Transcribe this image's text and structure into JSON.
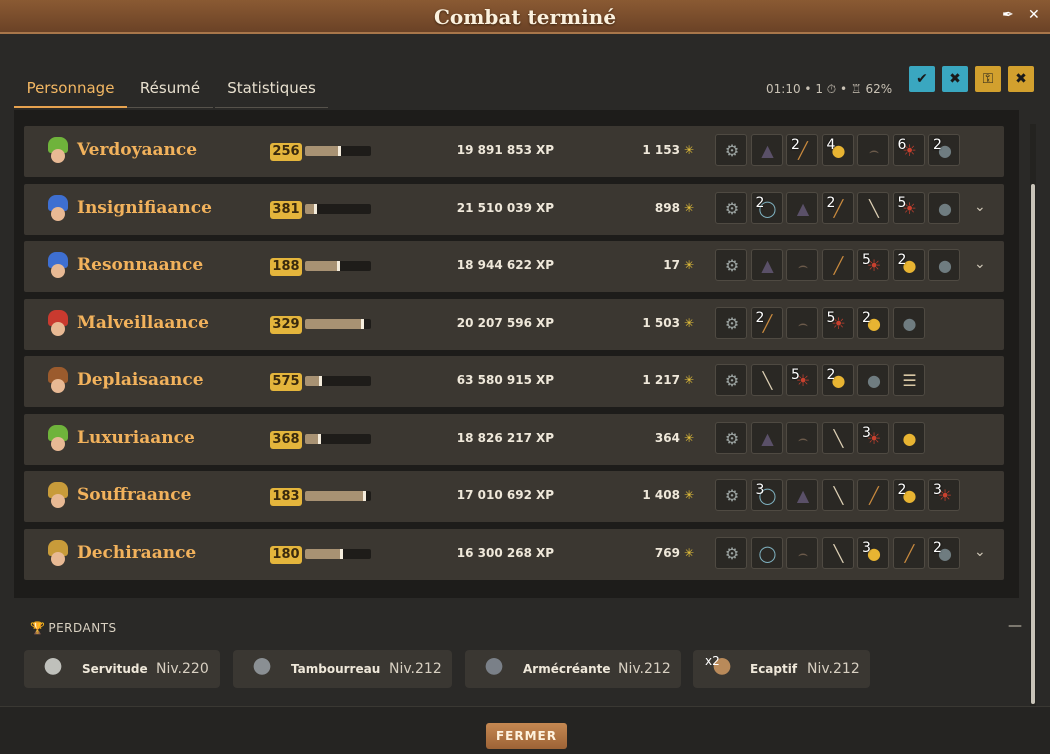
{
  "window": {
    "title": "Combat terminé"
  },
  "tabs": [
    {
      "label": "Personnage",
      "active": true
    },
    {
      "label": "Résumé",
      "active": false
    },
    {
      "label": "Statistiques",
      "active": false
    }
  ],
  "status": {
    "time": "01:10",
    "turns": "1",
    "challenge_pct": "62%"
  },
  "option_buttons": [
    {
      "icon": "check-groups-icon",
      "color": "#3aa7c0"
    },
    {
      "icon": "no-tree-icon",
      "color": "#3aa7c0"
    },
    {
      "icon": "lock-icon",
      "color": "#d2a02e"
    },
    {
      "icon": "no-helpers-icon",
      "color": "#d2a02e"
    }
  ],
  "players": [
    {
      "name": "Verdoyaance",
      "level": "256",
      "xp_progress": 0.55,
      "xp": "19 891 853",
      "xp_unit": "XP",
      "kamas": "1 153",
      "hat": "#6fb33b",
      "loot": [
        {
          "icon": "scrap-icon",
          "qty": ""
        },
        {
          "icon": "hood-icon",
          "qty": ""
        },
        {
          "icon": "staff-icon",
          "qty": "2"
        },
        {
          "icon": "coin-icon",
          "qty": "4"
        },
        {
          "icon": "whip-icon",
          "qty": ""
        },
        {
          "icon": "meat-icon",
          "qty": "6"
        },
        {
          "icon": "bomb-icon",
          "qty": "2"
        }
      ],
      "expandable": false
    },
    {
      "name": "Insignifiaance",
      "level": "381",
      "xp_progress": 0.18,
      "xp": "21 510 039",
      "xp_unit": "XP",
      "kamas": "898",
      "hat": "#3e6fd1",
      "loot": [
        {
          "icon": "scrap-icon",
          "qty": ""
        },
        {
          "icon": "ring-icon",
          "qty": "2"
        },
        {
          "icon": "hood-icon",
          "qty": ""
        },
        {
          "icon": "staff-icon",
          "qty": "2"
        },
        {
          "icon": "mace-icon",
          "qty": ""
        },
        {
          "icon": "meat-icon",
          "qty": "5"
        },
        {
          "icon": "bomb-icon",
          "qty": ""
        }
      ],
      "expandable": true
    },
    {
      "name": "Resonnaance",
      "level": "188",
      "xp_progress": 0.53,
      "xp": "18 944 622",
      "xp_unit": "XP",
      "kamas": "17",
      "hat": "#3e6fd1",
      "loot": [
        {
          "icon": "scrap-icon",
          "qty": ""
        },
        {
          "icon": "hood-icon",
          "qty": ""
        },
        {
          "icon": "whip-icon",
          "qty": ""
        },
        {
          "icon": "staff-icon",
          "qty": ""
        },
        {
          "icon": "meat-icon",
          "qty": "5"
        },
        {
          "icon": "coin-icon",
          "qty": "2"
        },
        {
          "icon": "bomb-icon",
          "qty": ""
        }
      ],
      "expandable": true
    },
    {
      "name": "Malveillaance",
      "level": "329",
      "xp_progress": 0.9,
      "xp": "20 207 596",
      "xp_unit": "XP",
      "kamas": "1 503",
      "hat": "#c93a2f",
      "loot": [
        {
          "icon": "scrap-icon",
          "qty": ""
        },
        {
          "icon": "staff-icon",
          "qty": "2"
        },
        {
          "icon": "whip-icon",
          "qty": ""
        },
        {
          "icon": "meat-icon",
          "qty": "5"
        },
        {
          "icon": "coin-icon",
          "qty": "2"
        },
        {
          "icon": "bomb-icon",
          "qty": ""
        }
      ],
      "expandable": false
    },
    {
      "name": "Deplaisaance",
      "level": "575",
      "xp_progress": 0.25,
      "xp": "63 580 915",
      "xp_unit": "XP",
      "kamas": "1 217",
      "hat": "#9b5b2d",
      "loot": [
        {
          "icon": "scrap-icon",
          "qty": ""
        },
        {
          "icon": "mace-icon",
          "qty": ""
        },
        {
          "icon": "meat-icon",
          "qty": "5"
        },
        {
          "icon": "coin-icon",
          "qty": "2"
        },
        {
          "icon": "bomb-icon",
          "qty": ""
        },
        {
          "icon": "scroll-icon",
          "qty": ""
        }
      ],
      "expandable": false
    },
    {
      "name": "Luxuriaance",
      "level": "368",
      "xp_progress": 0.24,
      "xp": "18 826 217",
      "xp_unit": "XP",
      "kamas": "364",
      "hat": "#6fb33b",
      "loot": [
        {
          "icon": "scrap-icon",
          "qty": ""
        },
        {
          "icon": "hood-icon",
          "qty": ""
        },
        {
          "icon": "whip-icon",
          "qty": ""
        },
        {
          "icon": "mace-icon",
          "qty": ""
        },
        {
          "icon": "meat-icon",
          "qty": "3"
        },
        {
          "icon": "coin-icon",
          "qty": ""
        }
      ],
      "expandable": false
    },
    {
      "name": "Souffraance",
      "level": "183",
      "xp_progress": 0.92,
      "xp": "17 010 692",
      "xp_unit": "XP",
      "kamas": "1 408",
      "hat": "#c89b3a",
      "loot": [
        {
          "icon": "scrap-icon",
          "qty": ""
        },
        {
          "icon": "ring-icon",
          "qty": "3"
        },
        {
          "icon": "hood-icon",
          "qty": ""
        },
        {
          "icon": "mace-icon",
          "qty": ""
        },
        {
          "icon": "staff-icon",
          "qty": ""
        },
        {
          "icon": "coin-icon",
          "qty": "2"
        },
        {
          "icon": "meat-icon",
          "qty": "3"
        }
      ],
      "expandable": false
    },
    {
      "name": "Dechiraance",
      "level": "180",
      "xp_progress": 0.58,
      "xp": "16 300 268",
      "xp_unit": "XP",
      "kamas": "769",
      "hat": "#c89b3a",
      "loot": [
        {
          "icon": "scrap-icon",
          "qty": ""
        },
        {
          "icon": "ring-icon",
          "qty": ""
        },
        {
          "icon": "whip-icon",
          "qty": ""
        },
        {
          "icon": "mace-icon",
          "qty": ""
        },
        {
          "icon": "coin-icon",
          "qty": "3"
        },
        {
          "icon": "staff-icon",
          "qty": ""
        },
        {
          "icon": "bomb-icon",
          "qty": "2"
        }
      ],
      "expandable": true
    }
  ],
  "losers": {
    "heading": "PERDANTS",
    "entries": [
      {
        "name": "Servitude",
        "level": "Niv.220",
        "mult": ""
      },
      {
        "name": "Tambourreau",
        "level": "Niv.212",
        "mult": ""
      },
      {
        "name": "Armécréante",
        "level": "Niv.212",
        "mult": ""
      },
      {
        "name": "Ecaptif",
        "level": "Niv.212",
        "mult": "x2"
      }
    ]
  },
  "footer": {
    "close_label": "FERMER"
  }
}
